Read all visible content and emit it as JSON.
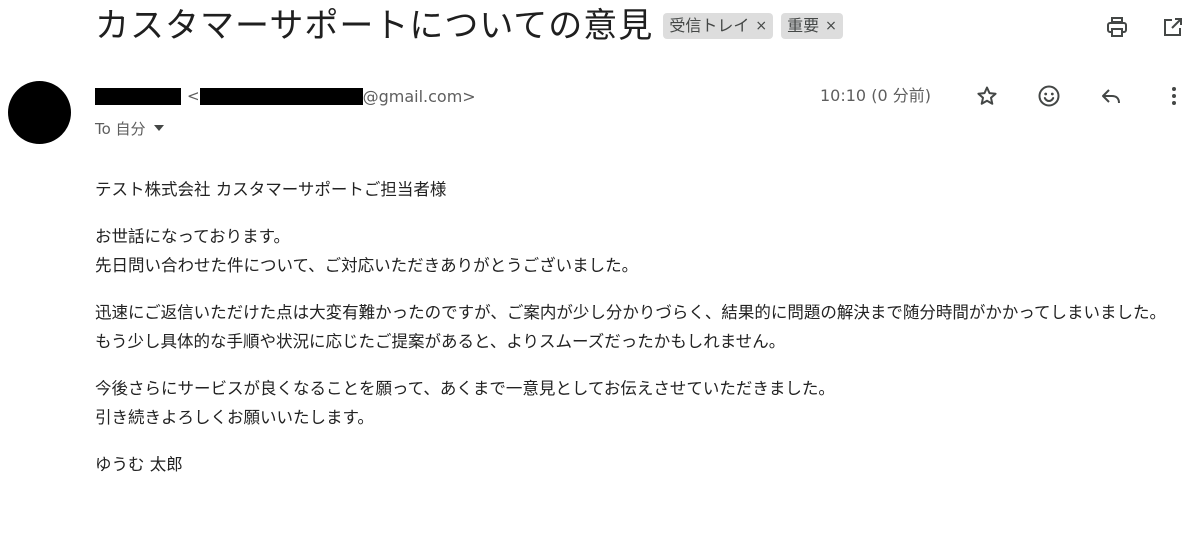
{
  "subject": "カスタマーサポートについての意見",
  "labels": [
    {
      "text": "受信トレイ",
      "remove": "×"
    },
    {
      "text": "重要",
      "remove": "×"
    }
  ],
  "header_icons": {
    "print": "print-icon",
    "open_new_window": "open-in-new-window-icon"
  },
  "sender": {
    "angle_open": "<",
    "email_domain": "@gmail.com>"
  },
  "recipient": {
    "label": "To 自分"
  },
  "time": "10:10 (0 分前)",
  "actions": {
    "star": "star-icon",
    "emoji": "emoji-icon",
    "reply": "reply-icon",
    "more": "more-vert-icon"
  },
  "body": {
    "greeting": "テスト株式会社 カスタマーサポートご担当者様",
    "p1": [
      "お世話になっております。",
      "先日問い合わせた件について、ご対応いただきありがとうございました。"
    ],
    "p2": [
      "迅速にご返信いただけた点は大変有難かったのですが、ご案内が少し分かりづらく、結果的に問題の解決まで随分時間がかかってしまいました。",
      "もう少し具体的な手順や状況に応じたご提案があると、よりスムーズだったかもしれません。"
    ],
    "p3": [
      "今後さらにサービスが良くなることを願って、あくまで一意見としてお伝えさせていただきました。",
      "引き続きよろしくお願いいたします。"
    ],
    "signature": "ゆうむ 太郎"
  }
}
